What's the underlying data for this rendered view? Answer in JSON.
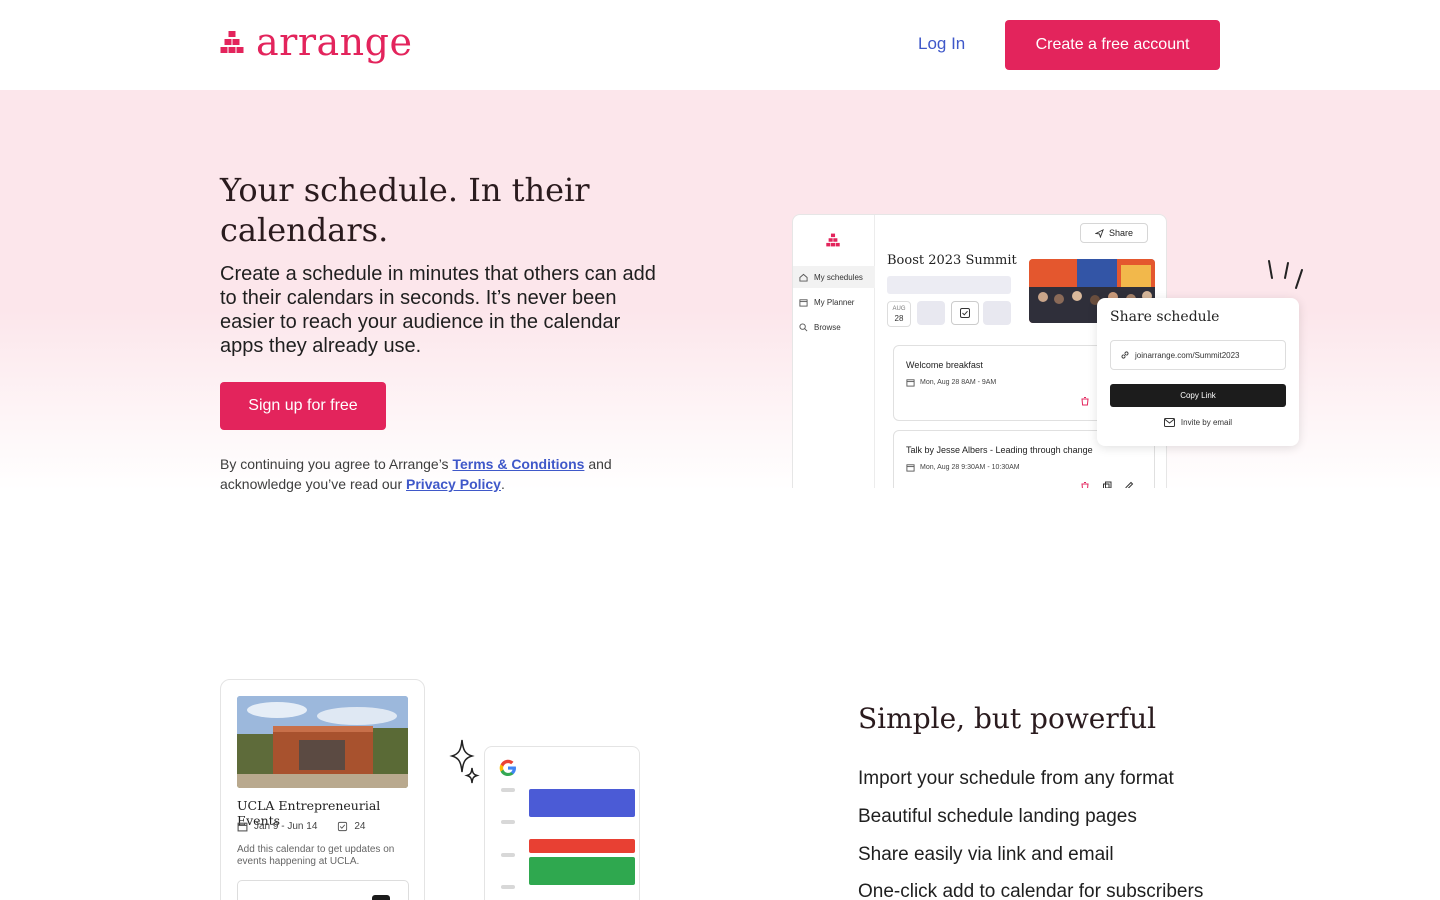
{
  "header": {
    "brand": "arrange",
    "login_label": "Log In",
    "cta_label": "Create a free account"
  },
  "hero": {
    "title": "Your schedule. In their calendars.",
    "subtitle": "Create a schedule in minutes that others can add to their calendars in seconds. It’s never been easier to reach your audience in the calendar apps they already use.",
    "cta_label": "Sign up for free",
    "legal": {
      "prefix": "By continuing you agree to Arrange’s",
      "terms": "Terms & Conditions",
      "middle": "and acknowledge you’ve read our",
      "privacy": "Privacy Policy",
      "suffix": "."
    }
  },
  "mock": {
    "nav": [
      "My schedules",
      "My Planner",
      "Browse"
    ],
    "share_label": "Share",
    "schedule_title": "Boost 2023 Summit",
    "date_month": "AUG",
    "date_day": "28",
    "events": [
      {
        "name": "Welcome breakfast",
        "time": "Mon, Aug 28 8AM - 9AM"
      },
      {
        "name": "Talk by Jesse Albers - Leading through change",
        "time": "Mon, Aug 28 9:30AM - 10:30AM"
      }
    ],
    "share_popup": {
      "title": "Share schedule",
      "link": "joinarrange.com/Summit2023",
      "copy_label": "Copy Link",
      "invite_label": "Invite by email"
    }
  },
  "features_card": {
    "title": "UCLA Entrepreneurial Events",
    "dates": "Jan 9 - Jun 14",
    "count": "24",
    "description": "Add this calendar to get updates on events happening at UCLA."
  },
  "features": {
    "title": "Simple, but powerful",
    "items": [
      "Import your schedule from any format",
      "Beautiful schedule landing pages",
      "Share easily via link and email",
      "One-click add to calendar for subscribers"
    ]
  },
  "colors": {
    "brand": "#e3245c",
    "link": "#3f58c9",
    "hero_bg": "#fce6eb",
    "google_blue": "#4b5bd6",
    "google_red": "#e84033",
    "google_green": "#2fa84f"
  }
}
